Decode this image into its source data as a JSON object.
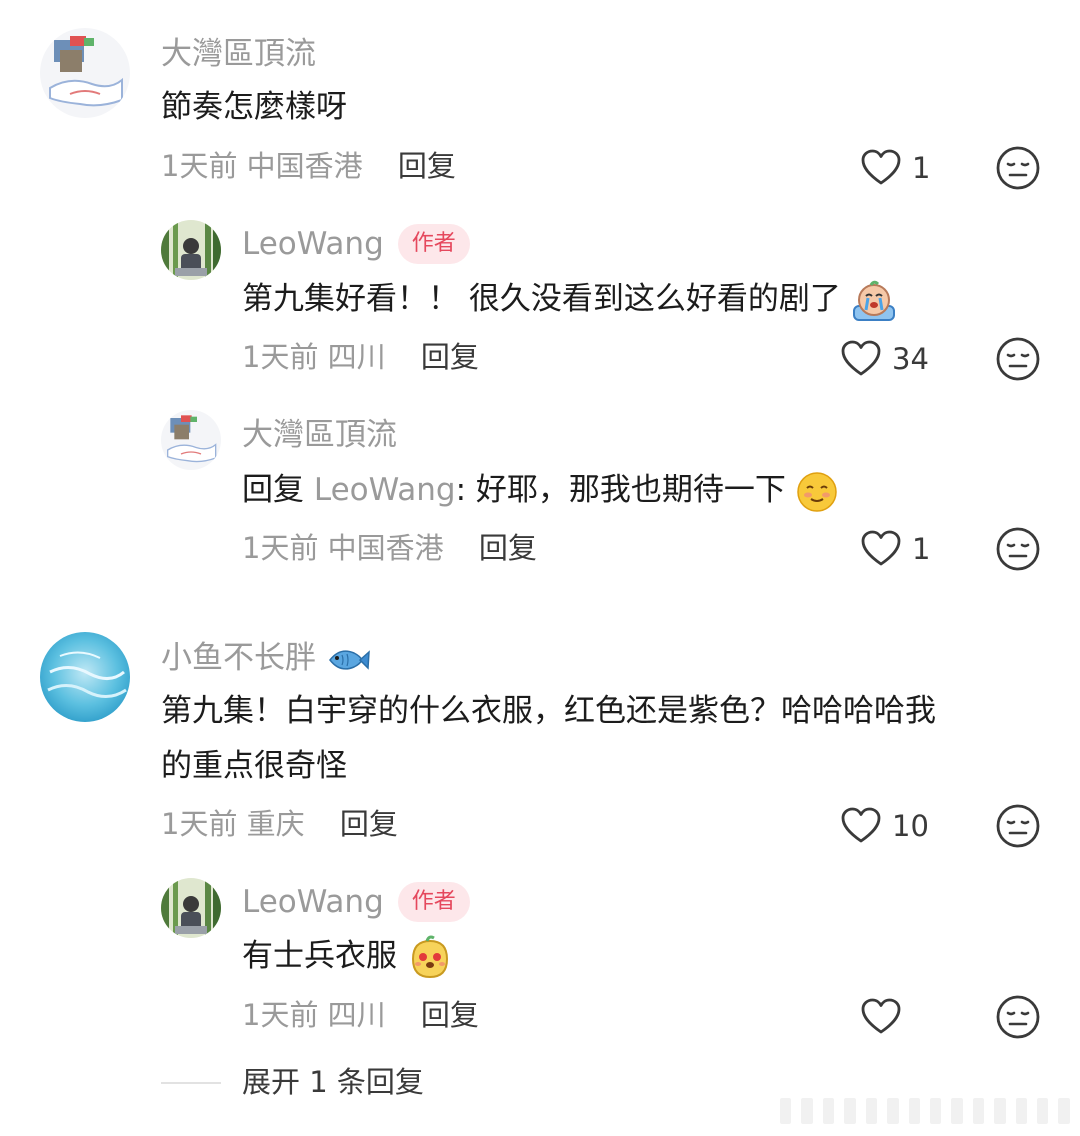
{
  "comments": [
    {
      "username": "大灣區頂流",
      "text": "節奏怎麼樣呀",
      "time": "1天前",
      "location": "中国香港",
      "reply_label": "回复",
      "likes": "1"
    },
    {
      "username": "LeoWang",
      "badge": "作者",
      "text": "第九集好看！！ 很久没看到这么好看的剧了",
      "time": "1天前",
      "location": "四川",
      "reply_label": "回复",
      "likes": "34"
    },
    {
      "username": "大灣區頂流",
      "reply_prefix": "回复",
      "mention": "LeoWang",
      "text": ": 好耶，那我也期待一下",
      "time": "1天前",
      "location": "中国香港",
      "reply_label": "回复",
      "likes": "1"
    },
    {
      "username": "小鱼不长胖",
      "text_line1": "第九集！白宇穿的什么衣服，红色还是紫色？哈哈哈哈我",
      "text_line2": "的重点很奇怪",
      "time": "1天前",
      "location": "重庆",
      "reply_label": "回复",
      "likes": "10"
    },
    {
      "username": "LeoWang",
      "badge": "作者",
      "text": "有士兵衣服",
      "time": "1天前",
      "location": "四川",
      "reply_label": "回复",
      "likes": ""
    }
  ],
  "expand_replies": "展开 1 条回复",
  "colors": {
    "meta_gray": "#9a9a9a",
    "badge_bg": "#fde7ea",
    "badge_text": "#e5485d"
  },
  "icons": [
    "heart-outline-icon",
    "neutral-face-icon",
    "crying-emoji",
    "smiling-emoji",
    "fish-emoji",
    "cute-face-emoji"
  ]
}
